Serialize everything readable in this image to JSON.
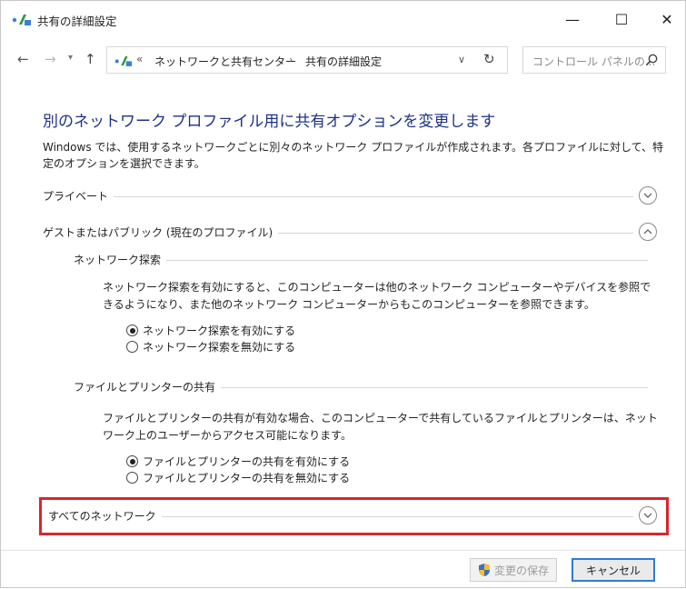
{
  "window": {
    "title": "共有の詳細設定",
    "minimize_glyph": "—",
    "maximize_glyph": "☐",
    "close_glyph": "✕"
  },
  "address_bar": {
    "chevron": "«",
    "crumbs": [
      "ネットワークと共有センター",
      "共有の詳細設定"
    ],
    "separator": "›",
    "search_placeholder": "コントロール パネルの..."
  },
  "page": {
    "title": "別のネットワーク プロファイル用に共有オプションを変更します",
    "description": "Windows では、使用するネットワークごとに別々のネットワーク プロファイルが作成されます。各プロファイルに対して、特定のオプションを選択できます。"
  },
  "profiles": {
    "private": {
      "label": "プライベート",
      "expanded": false
    },
    "guest_public": {
      "label": "ゲストまたはパブリック (現在のプロファイル)",
      "expanded": true
    },
    "all_networks": {
      "label": "すべてのネットワーク",
      "expanded": false
    }
  },
  "network_discovery": {
    "heading": "ネットワーク探索",
    "description": "ネットワーク探索を有効にすると、このコンピューターは他のネットワーク コンピューターやデバイスを参照できるようになり、また他のネットワーク コンピューターからもこのコンピューターを参照できます。",
    "options": [
      {
        "label": "ネットワーク探索を有効にする",
        "checked": true
      },
      {
        "label": "ネットワーク探索を無効にする",
        "checked": false
      }
    ]
  },
  "file_printer_sharing": {
    "heading": "ファイルとプリンターの共有",
    "description": "ファイルとプリンターの共有が有効な場合、このコンピューターで共有しているファイルとプリンターは、ネットワーク上のユーザーからアクセス可能になります。",
    "options": [
      {
        "label": "ファイルとプリンターの共有を有効にする",
        "checked": true
      },
      {
        "label": "ファイルとプリンターの共有を無効にする",
        "checked": false
      }
    ]
  },
  "footer": {
    "save_label": "変更の保存",
    "cancel_label": "キャンセル"
  },
  "colors": {
    "title_blue": "#1e3287",
    "highlight_red": "#d9262c",
    "focus_blue": "#2f7bd4"
  }
}
